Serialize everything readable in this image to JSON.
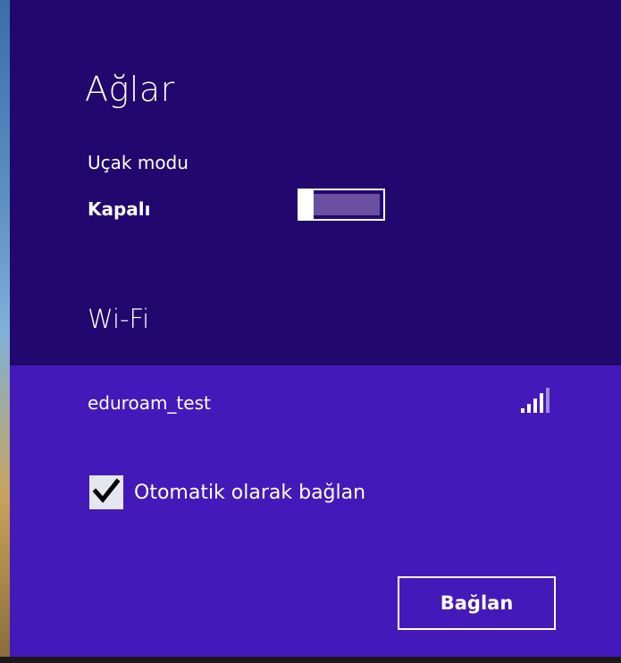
{
  "panel": {
    "title": "Ağlar",
    "background_color": "#22086e",
    "card_color": "#4419b9"
  },
  "airplane_mode": {
    "label": "Uçak modu",
    "state_text": "Kapalı",
    "enabled": false
  },
  "wifi": {
    "section_title": "Wi-Fi",
    "network": {
      "name": "eduroam_test",
      "signal_icon": "wifi-signal-bars-icon",
      "signal_bars": 4,
      "signal_bars_max": 5
    },
    "auto_connect": {
      "label": "Otomatik olarak bağlan",
      "checked": true
    },
    "connect_button_label": "Bağlan"
  }
}
